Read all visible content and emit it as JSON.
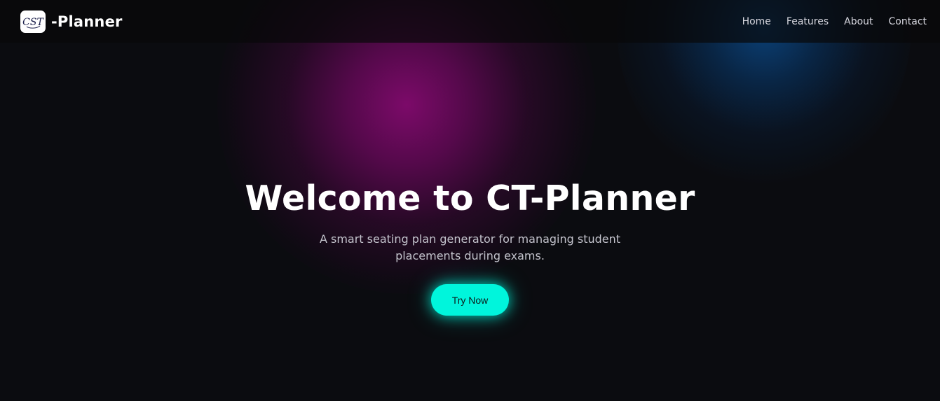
{
  "header": {
    "logo_text": "CST",
    "brand": "-Planner",
    "nav": [
      {
        "label": "Home"
      },
      {
        "label": "Features"
      },
      {
        "label": "About"
      },
      {
        "label": "Contact"
      }
    ]
  },
  "hero": {
    "title": "Welcome to CT-Planner",
    "subtitle": "A smart seating plan generator for managing student placements during exams.",
    "cta_label": "Try Now"
  },
  "colors": {
    "background": "#0b0c10",
    "accent": "#00f5dc",
    "glow_pink": "#820a6e",
    "glow_blue": "#0a4682"
  }
}
